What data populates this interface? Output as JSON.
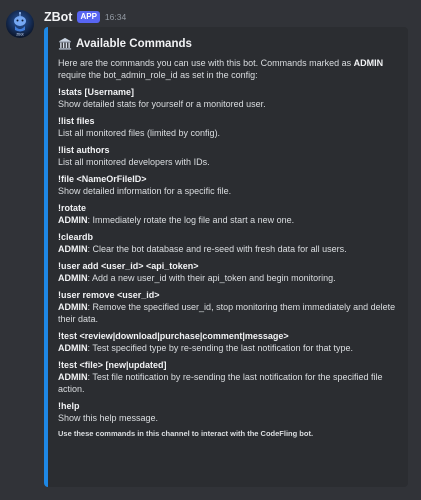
{
  "message": {
    "username": "ZBot",
    "badge": "APP",
    "timestamp": "16:34",
    "avatar_text": "ZBot"
  },
  "embed": {
    "accent_color": "#1e88e5",
    "title": "Available Commands",
    "title_icon": "classical-building-icon",
    "description": {
      "part1": "Here are the commands you can use with this bot. Commands marked as ",
      "admin": "ADMIN",
      "part2": " require the bot_admin_role_id as set in the config:"
    },
    "fields": [
      {
        "name": "!stats [Username]",
        "admin": "",
        "value": "Show detailed stats for yourself or a monitored user."
      },
      {
        "name": "!list files",
        "admin": "",
        "value": "List all monitored files (limited by config)."
      },
      {
        "name": "!list authors",
        "admin": "",
        "value": "List all monitored developers with IDs."
      },
      {
        "name": "!file <NameOrFileID>",
        "admin": "",
        "value": "Show detailed information for a specific file."
      },
      {
        "name": "!rotate",
        "admin": "ADMIN",
        "value": ": Immediately rotate the log file and start a new one."
      },
      {
        "name": "!cleardb",
        "admin": "ADMIN",
        "value": ": Clear the bot database and re-seed with fresh data for all users."
      },
      {
        "name": "!user add <user_id> <api_token>",
        "admin": "ADMIN",
        "value": ": Add a new user_id with their api_token and begin monitoring."
      },
      {
        "name": "!user remove <user_id>",
        "admin": "ADMIN",
        "value": ": Remove the specified user_id, stop monitoring them immediately and delete their data."
      },
      {
        "name": "!test <review|download|purchase|comment|message>",
        "admin": "ADMIN",
        "value": ": Test specified type by re-sending the last notification for that type."
      },
      {
        "name": "!test <file> [new|updated]",
        "admin": "ADMIN",
        "value": ": Test file notification by re-sending the last notification for the specified file action."
      },
      {
        "name": "!help",
        "admin": "",
        "value": "Show this help message."
      }
    ],
    "footer": "Use these commands in this channel to interact with the CodeFling bot."
  }
}
